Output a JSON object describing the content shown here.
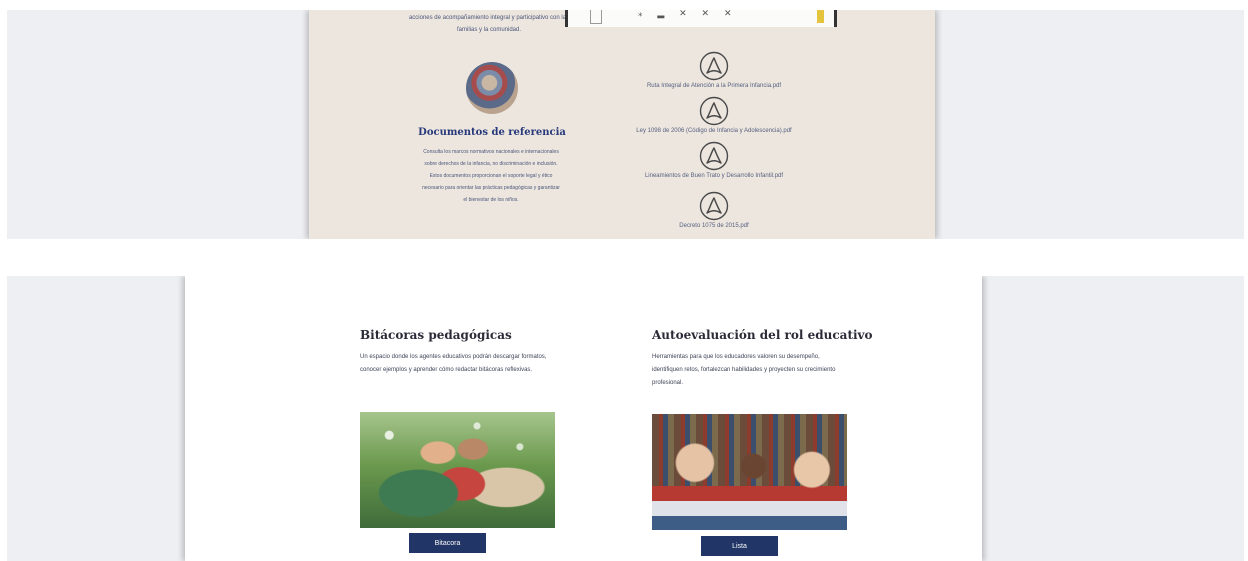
{
  "top_section": {
    "intro_text": "acciones de acompañamiento integral y participativo con las familias y la comunidad.",
    "documents_title": "Documentos de referencia",
    "documents_description": "Consulta los marcos normativos nacionales e internacionales sobre derechos de la infancia, no discriminación e inclusión. Estos documentos proporcionan el soporte legal y ético necesario para orientar las prácticas pedagógicas y garantizar el bienestar de los niños.",
    "pdf_icon": "pdf-acrobat-icon",
    "pdf_files": [
      {
        "name": "Ruta Integral de Atención a la Primera Infancia.pdf"
      },
      {
        "name": "Ley 1098 de 2006 (Código de Infancia y Adolescencia).pdf"
      },
      {
        "name": "Lineamientos de Buen Trato y Desarrollo Infantil.pdf"
      },
      {
        "name": "Decreto 1075 de 2015.pdf"
      }
    ]
  },
  "bottom_section": {
    "left": {
      "title": "Bitácoras pedagógicas",
      "description": "Un espacio donde los agentes educativos podrán descargar formatos, conocer ejemplos y aprender cómo redactar bitácoras reflexivas.",
      "button_label": "Bitacora"
    },
    "right": {
      "title": "Autoevaluación del rol educativo",
      "description": "Herramientas para que los educadores valoren su desempeño, identifiquen retos, fortalezcan habilidades y proyecten su crecimiento profesional.",
      "button_label": "Lista"
    }
  },
  "colors": {
    "accent": "#213566",
    "heading_blue": "#27397a",
    "card_beige": "#ece6df",
    "page_gray": "#eeeff3"
  }
}
